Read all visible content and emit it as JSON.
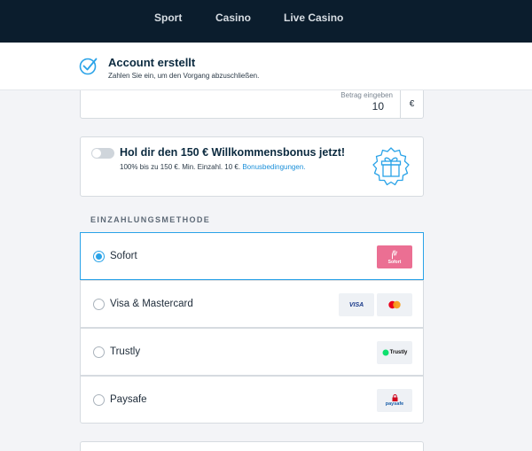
{
  "nav": {
    "items": [
      {
        "label": "Sport"
      },
      {
        "label": "Casino"
      },
      {
        "label": "Live Casino"
      }
    ]
  },
  "banner": {
    "title": "Account erstellt",
    "subtitle": "Zahlen Sie ein, um den Vorgang abzuschließen.",
    "icon": "checkmark-circle-icon"
  },
  "amount": {
    "label": "Betrag eingeben",
    "value": "10",
    "currency": "€"
  },
  "bonus": {
    "title": "Hol dir den 150 € Willkommensbonus jetzt!",
    "subtitle": "100% bis zu 150 €. Min. Einzahl. 10 €.",
    "link": "Bonusbedingungen.",
    "toggle_on": false,
    "icon": "gift-icon"
  },
  "payment": {
    "section_label": "EINZAHLUNGSMETHODE",
    "methods": [
      {
        "label": "Sofort",
        "selected": true,
        "logo_text": "Sofort"
      },
      {
        "label": "Visa & Mastercard",
        "selected": false,
        "logo_text": "VISA"
      },
      {
        "label": "Trustly",
        "selected": false,
        "logo_text": "Trustly"
      },
      {
        "label": "Paysafe",
        "selected": false,
        "logo_text": "paysafe"
      }
    ]
  },
  "colors": {
    "nav_bg": "#0b1d2d",
    "accent": "#2aa3e8",
    "link": "#1a8fd9",
    "sofort": "#eb6f93",
    "trustly": "#0ee06e"
  }
}
